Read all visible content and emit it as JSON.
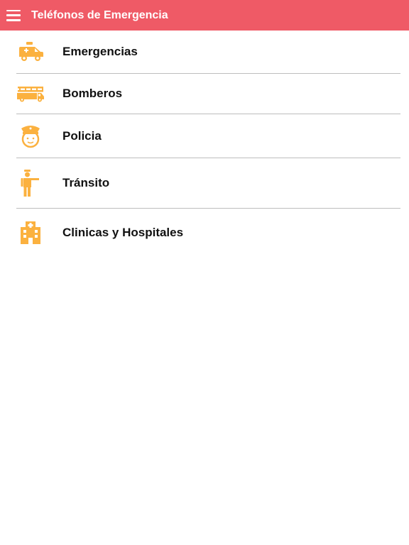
{
  "header": {
    "title": "Teléfonos de Emergencia",
    "menu_icon": "hamburger-menu-icon"
  },
  "colors": {
    "header_bg": "#ef5a66",
    "icon": "#fbb13f",
    "divider": "#bdbdbd",
    "text": "#111111"
  },
  "list": {
    "items": [
      {
        "label": "Emergencias",
        "icon": "ambulance-icon"
      },
      {
        "label": "Bomberos",
        "icon": "fire-truck-icon"
      },
      {
        "label": "Policia",
        "icon": "police-officer-icon"
      },
      {
        "label": "Tránsito",
        "icon": "traffic-officer-icon"
      },
      {
        "label": "Clinicas y Hospitales",
        "icon": "hospital-icon"
      }
    ]
  }
}
